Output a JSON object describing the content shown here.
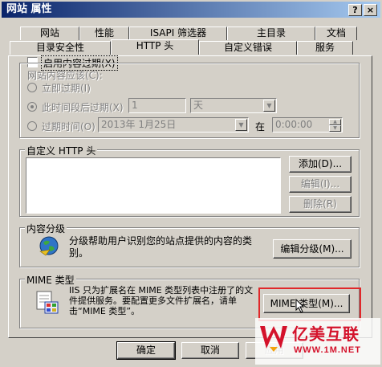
{
  "window": {
    "title": "网站 属性",
    "help_label": "?",
    "close_label": "×"
  },
  "tabs_row1": [
    "网站",
    "性能",
    "ISAPI 筛选器",
    "主目录",
    "文档"
  ],
  "tabs_row2": [
    "目录安全性",
    "HTTP 头",
    "自定义错误",
    "服务"
  ],
  "expire": {
    "enable_label": "启用内容过期(X)",
    "subtitle": "网站内容应该(C):",
    "immediate_label": "立即过期(I)",
    "after_label": "此时间段后过期(X)",
    "after_value": "1",
    "unit_value": "天",
    "on_label": "过期时间(O)",
    "date_value": "2013年 1月25日",
    "at_label": "在",
    "time_value": "0:00:00"
  },
  "custom_headers": {
    "title": "自定义 HTTP 头",
    "add_label": "添加(D)...",
    "edit_label": "编辑(I)...",
    "delete_label": "删除(R)"
  },
  "rating": {
    "title": "内容分级",
    "description": "分级帮助用户识别您的站点提供的内容的类别。",
    "edit_label": "编辑分级(M)..."
  },
  "mime": {
    "title": "MIME 类型",
    "description": "IIS 只为扩展名在 MIME 类型列表中注册了的文件提供服务。要配置更多文件扩展名，请单击“MIME 类型”。",
    "button_label": "MIME 类型(M)..."
  },
  "footer": {
    "ok_label": "确定",
    "cancel_label": "取消",
    "apply_label": "应用"
  },
  "watermark": {
    "brand": "亿美互联",
    "url": "WWW.1M.NET"
  },
  "colors": {
    "title_start": "#0a246a",
    "title_end": "#a6caf0",
    "highlight": "#e0282a",
    "watermark_red": "#d4122b"
  }
}
